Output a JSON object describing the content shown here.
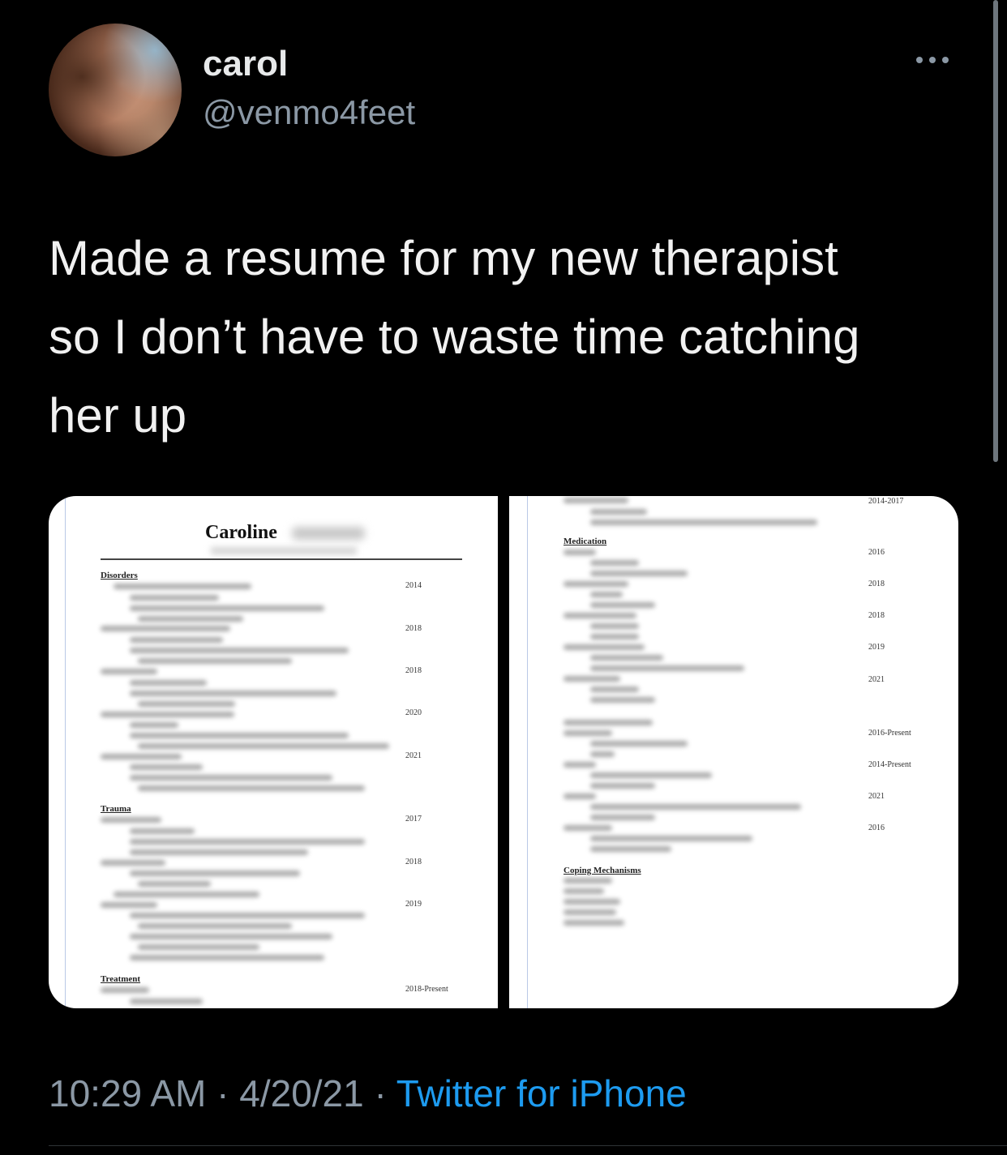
{
  "tweet": {
    "display_name": "carol",
    "handle": "@venmo4feet",
    "text_lines": [
      "Made a resume for my new therapist",
      "so I don’t have to waste time catching",
      "her up"
    ],
    "time": "10:29 AM",
    "date": "4/20/21",
    "source": "Twitter for iPhone",
    "separator": "·"
  },
  "resume_left": {
    "name": "Caroline",
    "sections": [
      "Disorders",
      "Trauma",
      "Treatment"
    ],
    "years": [
      "2014",
      "2018",
      "2018",
      "2020",
      "2021",
      "2017",
      "2018",
      "2019",
      "2018-Present"
    ]
  },
  "resume_right": {
    "top_year": "2014-2017",
    "sections": [
      "Medication",
      "Coping Mechanisms"
    ],
    "years": [
      "2016",
      "2018",
      "2018",
      "2019",
      "2021",
      "2016-Present",
      "2014-Present",
      "2021",
      "2016"
    ]
  },
  "colors": {
    "background": "#000000",
    "primary_text": "#e7e9ea",
    "secondary_text": "#8b98a5",
    "link": "#1d9bf0"
  }
}
